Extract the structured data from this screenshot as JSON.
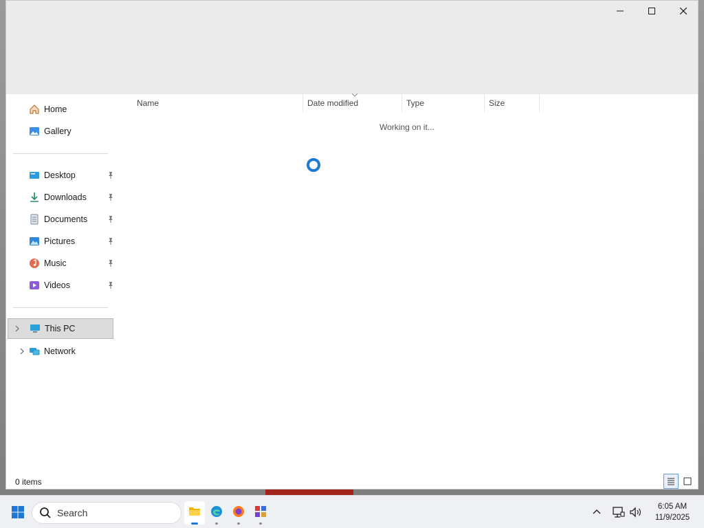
{
  "window": {
    "caption_buttons": [
      "minimize",
      "maximize",
      "close"
    ]
  },
  "nav": {
    "quick": [
      {
        "label": "Home",
        "icon": "home-icon"
      },
      {
        "label": "Gallery",
        "icon": "gallery-icon"
      }
    ],
    "pinned": [
      {
        "label": "Desktop",
        "icon": "desktop-folder-icon",
        "pinned": true
      },
      {
        "label": "Downloads",
        "icon": "downloads-icon",
        "pinned": true
      },
      {
        "label": "Documents",
        "icon": "documents-icon",
        "pinned": true
      },
      {
        "label": "Pictures",
        "icon": "pictures-icon",
        "pinned": true
      },
      {
        "label": "Music",
        "icon": "music-icon",
        "pinned": true
      },
      {
        "label": "Videos",
        "icon": "videos-icon",
        "pinned": true
      }
    ],
    "drives": [
      {
        "label": "This PC",
        "icon": "this-pc-icon",
        "selected": true
      },
      {
        "label": "Network",
        "icon": "network-icon",
        "selected": false
      }
    ]
  },
  "columns": {
    "name": "Name",
    "date_modified": "Date modified",
    "type": "Type",
    "size": "Size"
  },
  "content": {
    "status_message": "Working on it..."
  },
  "statusbar": {
    "item_count": "0 items"
  },
  "taskbar": {
    "search_placeholder": "Search",
    "apps": [
      {
        "name": "file-explorer",
        "active": true
      },
      {
        "name": "edge",
        "active": false
      },
      {
        "name": "firefox",
        "active": false
      },
      {
        "name": "app",
        "active": false
      }
    ],
    "clock": {
      "time": "6:05 AM",
      "date": "11/9/2025"
    }
  },
  "colors": {
    "accent": "#1e78d4",
    "titlebar": "#ebebeb",
    "selected_nav": "#dcdcdc"
  }
}
